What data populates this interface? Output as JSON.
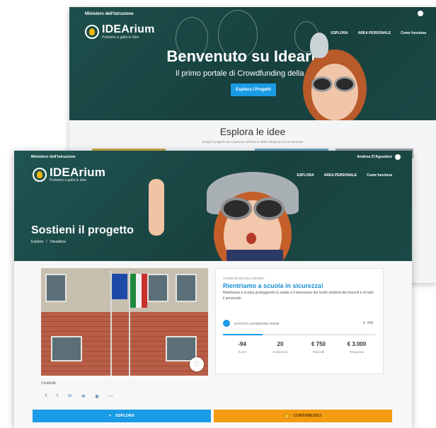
{
  "back_page": {
    "ministry": "Ministero dell'Istruzione",
    "logo": {
      "name": "IDEArium",
      "tagline": "Portiamo a galla le idee"
    },
    "nav": [
      "ESPLORA",
      "AREA PERSONALE",
      "Come funziona"
    ],
    "hero_title": "Benvenuto su Idearium",
    "hero_subtitle": "Il primo portale di Crowdfunding della Scuola",
    "hero_button": "Esplora i Progetti",
    "explore_title": "Esplora le idee",
    "explore_subtitle": "Scegli il progetto da sostenere all'interno delle categorie di tuo interesse"
  },
  "front_page": {
    "ministry": "Ministero dell'Istruzione",
    "user_name": "Andrea D'Agostino",
    "logo": {
      "name": "IDEArium",
      "tagline": "Portiamo a galla le idee"
    },
    "nav": [
      "ESPLORA",
      "AREA PERSONALE",
      "Come funziona"
    ],
    "page_title": "Sostieni il progetto",
    "breadcrumb": [
      "Esplora",
      "/",
      "Visualizza"
    ],
    "project": {
      "category": "COVID-19 SCUOLA SICURA",
      "title": "Rientriamo a scuola in sicurezza!",
      "description": "Rientriamo a scuola proteggendo la salute e il benessere dei nostri studenti dei docenti e di tutto il personale.",
      "school": "ISTITUTO SUPERIORE FERMI",
      "location": "RM",
      "progress": 0.26,
      "stats": [
        {
          "value": "-94",
          "label": "Giorni"
        },
        {
          "value": "20",
          "label": "Sostenitori"
        },
        {
          "value": "€ 750",
          "label": "Raccolti"
        },
        {
          "value": "€ 3.000",
          "label": "Traguardo"
        }
      ]
    },
    "share_label": "Condividi",
    "share_icons": [
      "f",
      "t",
      "in",
      "✉",
      "◉",
      "⋯"
    ],
    "btn_explore": "ESPLORA",
    "btn_contribute": "CONTRIBUISCI"
  },
  "colors": {
    "hero_green": "#1d4f4c",
    "accent_blue": "#1a9be6",
    "accent_orange": "#f39c12",
    "title_blue": "#1a8fd1"
  }
}
